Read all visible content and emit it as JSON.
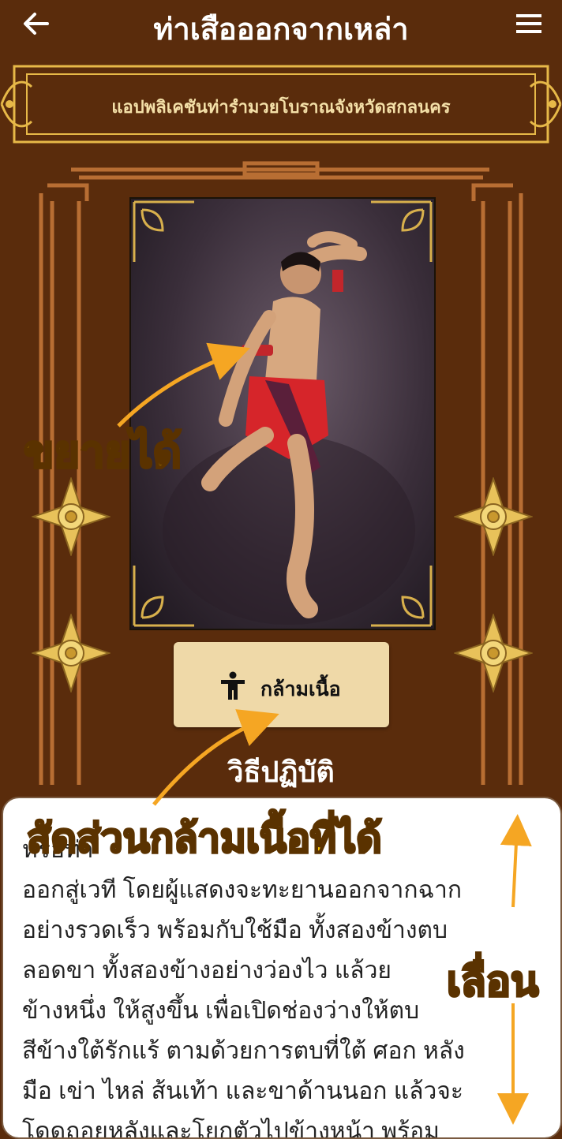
{
  "appbar": {
    "title": "ท่าเสือออกจากเหล่า",
    "back_icon": "arrow-left-icon",
    "menu_icon": "hamburger-menu-icon"
  },
  "banner": {
    "text": "แอปพลิเคชันท่ารำมวยโบราณจังหวัดสกลนคร"
  },
  "photo": {
    "subject": "muay-boran-dancer"
  },
  "muscle_button": {
    "label": "กล้ามเนื้อ",
    "icon": "person-icon"
  },
  "section": {
    "title": "วิธีปฏิบัติ"
  },
  "description": {
    "text": "หรือท่า\nออกสู่เวที โดยผู้แสดงจะทะยานออกจากฉาก\nอย่างรวดเร็ว พร้อมกับใช้มือ ทั้งสองข้างตบ\nลอดขา ทั้งสองข้างอย่างว่องไว แล้วย\nข้างหนึ่ง ให้สูงขึ้น เพื่อเปิดช่องว่างให้ตบ\nสีข้างใต้รักแร้ ตามด้วยการตบที่ใต้ ศอก หลัง\nมือ เข่า ไหล่ ส้นเท้า และขาด้านนอก แล้วจะ\nโดดถอยหลังและโยกตัวไปข้างหน้า พร้อม"
  },
  "annotations": {
    "zoom": "ขยายได้",
    "muscle_ratio": "สัดส่วนกล้ามเนื้อที่ได้",
    "scroll": "เลื่อน"
  },
  "colors": {
    "background": "#5a2c0c",
    "gold": "#f4c542",
    "button_bg": "#efd9a8",
    "annotation_yellow": "#f7c400",
    "arrow_orange": "#f5a623"
  }
}
